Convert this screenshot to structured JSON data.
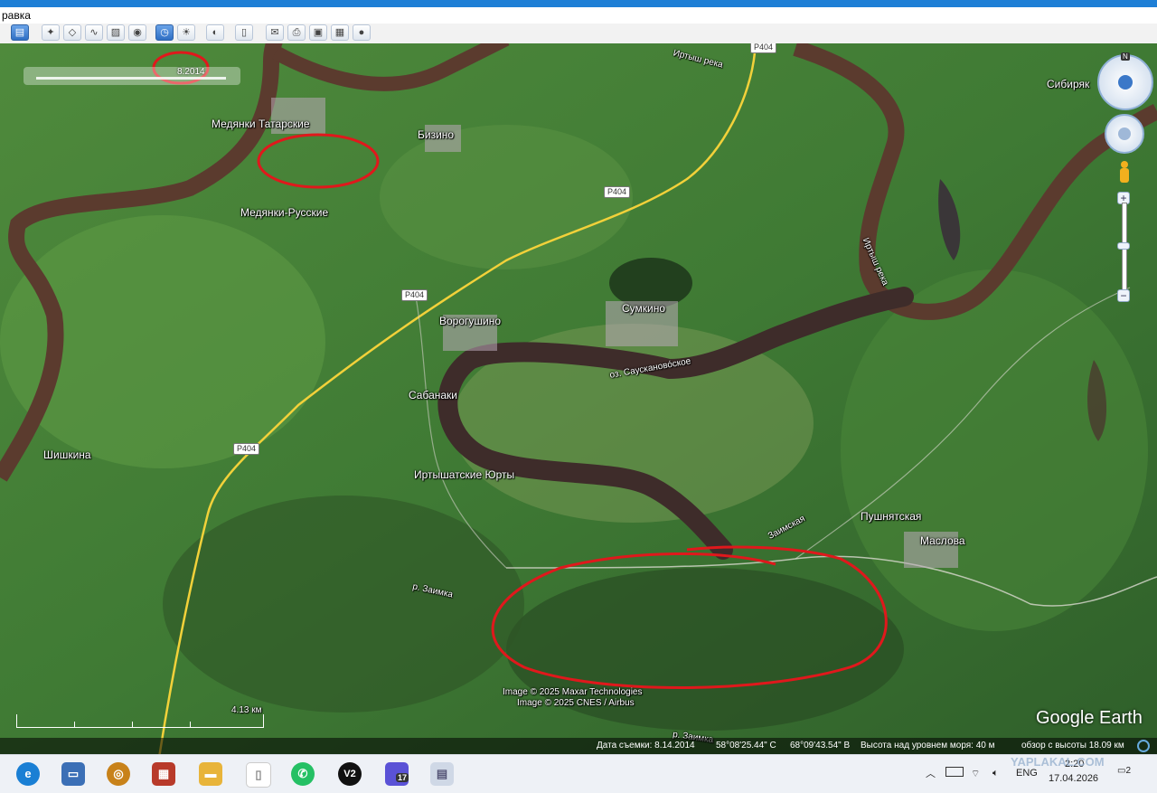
{
  "menu": {
    "visible_text": "равка"
  },
  "toolbar": {
    "buttons": [
      "show-sidebar",
      "add-placemark",
      "add-polygon",
      "add-path",
      "add-overlay",
      "record-tour",
      "historical-imagery",
      "sunlight",
      "switch-planet",
      "ruler",
      "email",
      "print",
      "save-image",
      "view-in-maps",
      "earth-view"
    ]
  },
  "time_slider": {
    "date": "8.2014"
  },
  "map_labels": {
    "medyanki_tatarskie": "Медянки Татарские",
    "bizino": "Бизино",
    "medyanki_russkie": "Медянки-Русские",
    "sibiryak": "Сибиряк",
    "irtysh_top": "Иртыш река",
    "irtysh_right": "Иртыш река",
    "sumkino": "Сумкино",
    "vorogushino": "Ворогушино",
    "lake": "оз. Саусканово́ское",
    "sabanaki": "Сабанаки",
    "shishkina": "Шишкина",
    "irtyshatskie": "Иртышатские Юрты",
    "zaimskaya": "Заимская",
    "pushnyatskaya": "Пушнятская",
    "maslova": "Маслова",
    "r_zaimka": "р. Заимка",
    "r_zaimka_bottom": "р. Заимка"
  },
  "road_shields": [
    "Р404",
    "Р404",
    "Р404",
    "Р404"
  ],
  "attribution": {
    "line1": "Image © 2025 Maxar Technologies",
    "line2": "Image © 2025 CNES / Airbus"
  },
  "scale": {
    "label": "4.13 км"
  },
  "logo": "Google Earth",
  "status": {
    "capture_date": "Дата съемки: 8.14.2014",
    "lat": "58°08'25.44\" С",
    "lon": "68°09'43.54\" В",
    "elevation": "Высота над уровнем моря:   40 м",
    "eye_alt": "обзор с высоты  18.09 км"
  },
  "taskbar": {
    "apps": [
      "edge",
      "computer",
      "app-3",
      "app-4",
      "file-explorer",
      "notepad",
      "whatsapp",
      "v2",
      "app-17",
      "app-photos"
    ],
    "v2_label": "V2",
    "badge": "17",
    "lang": "ENG",
    "time": "2:20",
    "date": "17.04.2026",
    "notifications": "2",
    "watermark": "YAPLAKAL.COM"
  },
  "colors": {
    "accent": "#1e7fd6",
    "annotation": "#e0181c",
    "river": "#5b3b2e",
    "road": "#f2d13a"
  }
}
